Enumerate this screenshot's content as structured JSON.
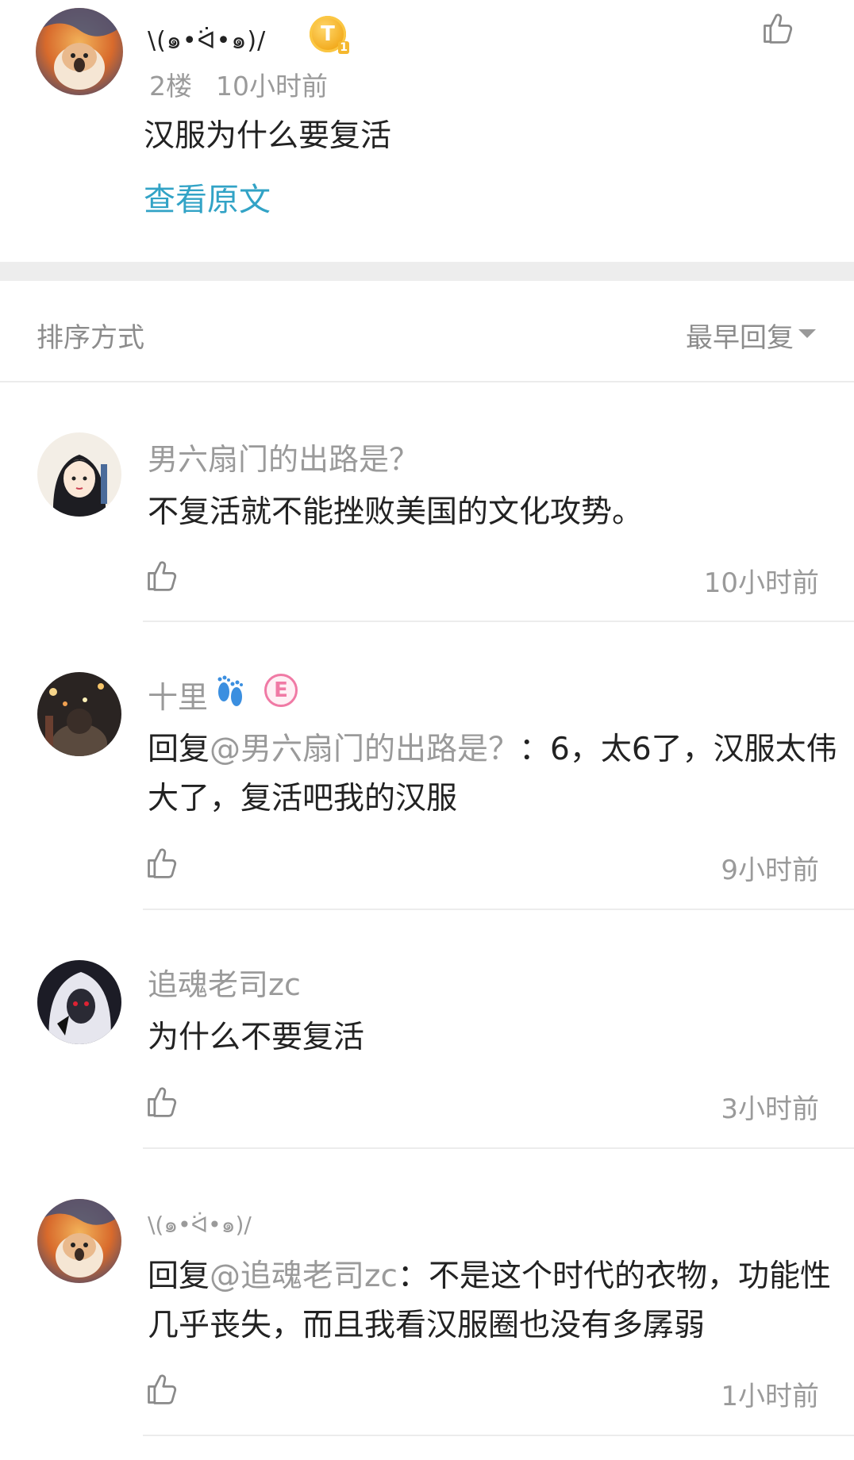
{
  "post": {
    "author": "\\(๑•ᐛ•๑)/",
    "level_badge": "T",
    "floor": "2楼",
    "time": "10小时前",
    "text": "汉服为什么要复活",
    "view_original": "查看原文"
  },
  "sort": {
    "label": "排序方式",
    "value": "最早回复"
  },
  "replies": [
    {
      "name": "男六扇门的出路是？",
      "text": "不复活就不能挫败美国的文化攻势。",
      "mention": "",
      "time": "10小时前"
    },
    {
      "name": "十里",
      "badge": "E",
      "reply_prefix": "回复",
      "mention": "@男六扇门的出路是？",
      "text": "：6，太6了，汉服太伟大了，复活吧我的汉服",
      "time": "9小时前"
    },
    {
      "name": "追魂老司zc",
      "text": "为什么不要复活",
      "mention": "",
      "time": "3小时前"
    },
    {
      "name": "\\(๑•ᐛ•๑)/",
      "reply_prefix": "回复",
      "mention": "@追魂老司zc",
      "text": "：不是这个时代的衣物，功能性几乎丧失，而且我看汉服圈也没有多孱弱",
      "time": "1小时前"
    }
  ],
  "colors": {
    "accent_link": "#32a3c6",
    "muted_text": "#9a9a9a",
    "body_text": "#222222",
    "separator": "#ededed"
  },
  "icons": [
    "thumbs-up-icon",
    "caret-down-icon",
    "level-badge-icon",
    "footprints-icon",
    "e-badge-icon"
  ]
}
